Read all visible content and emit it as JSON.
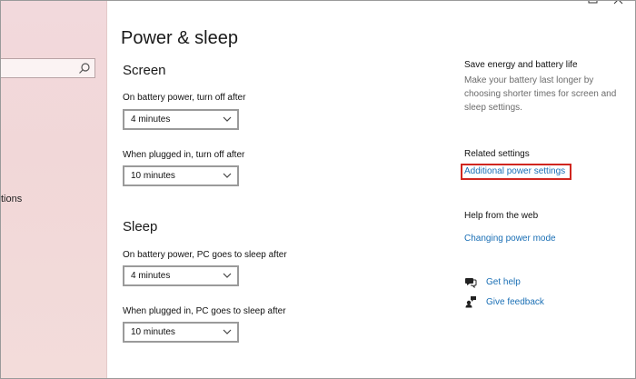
{
  "window": {
    "title": "Power & sleep",
    "controls": {
      "maximize_icon": "maximize-icon",
      "close_icon": "close-icon"
    }
  },
  "nav": {
    "search_icon": "search-icon",
    "partial_item": "tions"
  },
  "screen": {
    "title": "Screen",
    "battery_label": "On battery power, turn off after",
    "battery_value": "4 minutes",
    "plugged_label": "When plugged in, turn off after",
    "plugged_value": "10 minutes"
  },
  "sleep": {
    "title": "Sleep",
    "battery_label": "On battery power, PC goes to sleep after",
    "battery_value": "4 minutes",
    "plugged_label": "When plugged in, PC goes to sleep after",
    "plugged_value": "10 minutes"
  },
  "right": {
    "save_heading": "Save energy and battery life",
    "save_text": "Make your battery last longer by choosing shorter times for screen and sleep settings.",
    "related_heading": "Related settings",
    "related_link": "Additional power settings",
    "web_heading": "Help from the web",
    "web_link": "Changing power mode",
    "get_help": "Get help",
    "give_feedback": "Give feedback"
  },
  "colors": {
    "link": "#1a6fb5",
    "highlight": "#d0261f",
    "nav_background": "#f2d9dc"
  }
}
